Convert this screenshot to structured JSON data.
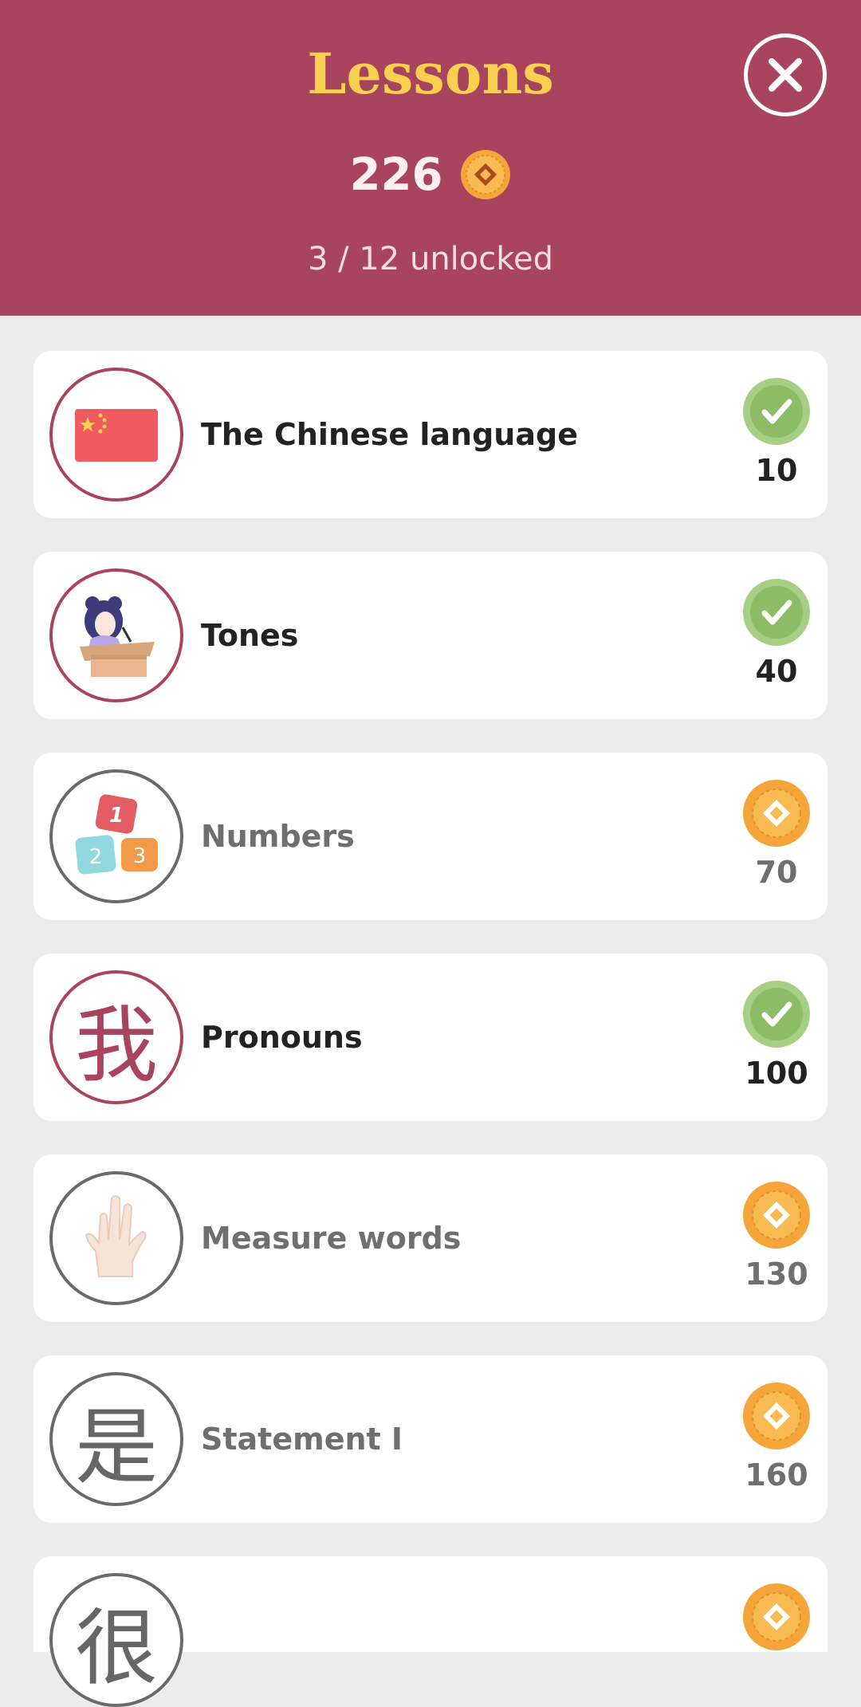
{
  "header": {
    "title": "Lessons",
    "coins": "226",
    "unlocked_text": "3 / 12 unlocked"
  },
  "lessons": [
    {
      "label": "The Chinese language",
      "price": "10",
      "status": "completed",
      "icon": "china-flag-icon"
    },
    {
      "label": "Tones",
      "price": "40",
      "status": "completed",
      "icon": "speaker-girl-icon"
    },
    {
      "label": "Numbers",
      "price": "70",
      "status": "locked",
      "icon": "number-blocks-icon"
    },
    {
      "label": "Pronouns",
      "price": "100",
      "status": "completed",
      "icon": "hanzi-wo-icon",
      "glyph": "我"
    },
    {
      "label": "Measure words",
      "price": "130",
      "status": "locked",
      "icon": "hand-icon"
    },
    {
      "label": "Statement I",
      "price": "160",
      "status": "locked",
      "icon": "hanzi-shi-icon",
      "glyph": "是"
    },
    {
      "label": "",
      "price": "",
      "status": "locked",
      "icon": "hanzi-hen-icon",
      "glyph": "很"
    }
  ],
  "colors": {
    "header_bg": "#a8445e",
    "title": "#f9d04f",
    "completed_badge": "#8fbf6a",
    "coin": "#f5a53a",
    "locked_text": "#6f6f6f"
  }
}
